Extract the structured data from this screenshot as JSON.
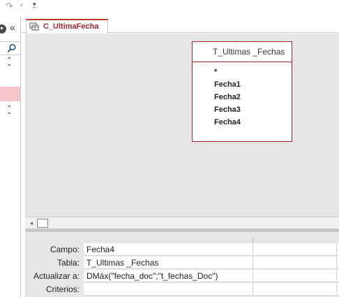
{
  "toolbar": {
    "redo_icon": "redo-icon",
    "customize_icon": "customize-quick-access-icon"
  },
  "nav": {
    "dropdown_icon": "chevron-down-icon",
    "collapse_glyph": "«",
    "search_icon": "search-icon",
    "selected_highlight_color": "#f5c6c9"
  },
  "tab": {
    "label": "C_UltimaFecha",
    "icon": "query-icon",
    "accent_color": "#a4262c"
  },
  "table_box": {
    "title": "T_Ultimas _Fechas",
    "fields": [
      "*",
      "Fecha1",
      "Fecha2",
      "Fecha3",
      "Fecha4"
    ],
    "border_color": "#a4262c"
  },
  "grid": {
    "labels": {
      "campo": "Campo:",
      "tabla": "Tabla:",
      "actualizar": "Actualizar a:",
      "criterios": "Criterios:"
    },
    "column1": {
      "campo": "Fecha4",
      "tabla": "T_Ultimas _Fechas",
      "actualizar": "DMáx(\"fecha_doc\";\"t_fechas_Doc\")",
      "criterios": ""
    },
    "column2": {
      "campo": "",
      "tabla": "",
      "actualizar": "",
      "criterios": ""
    }
  }
}
